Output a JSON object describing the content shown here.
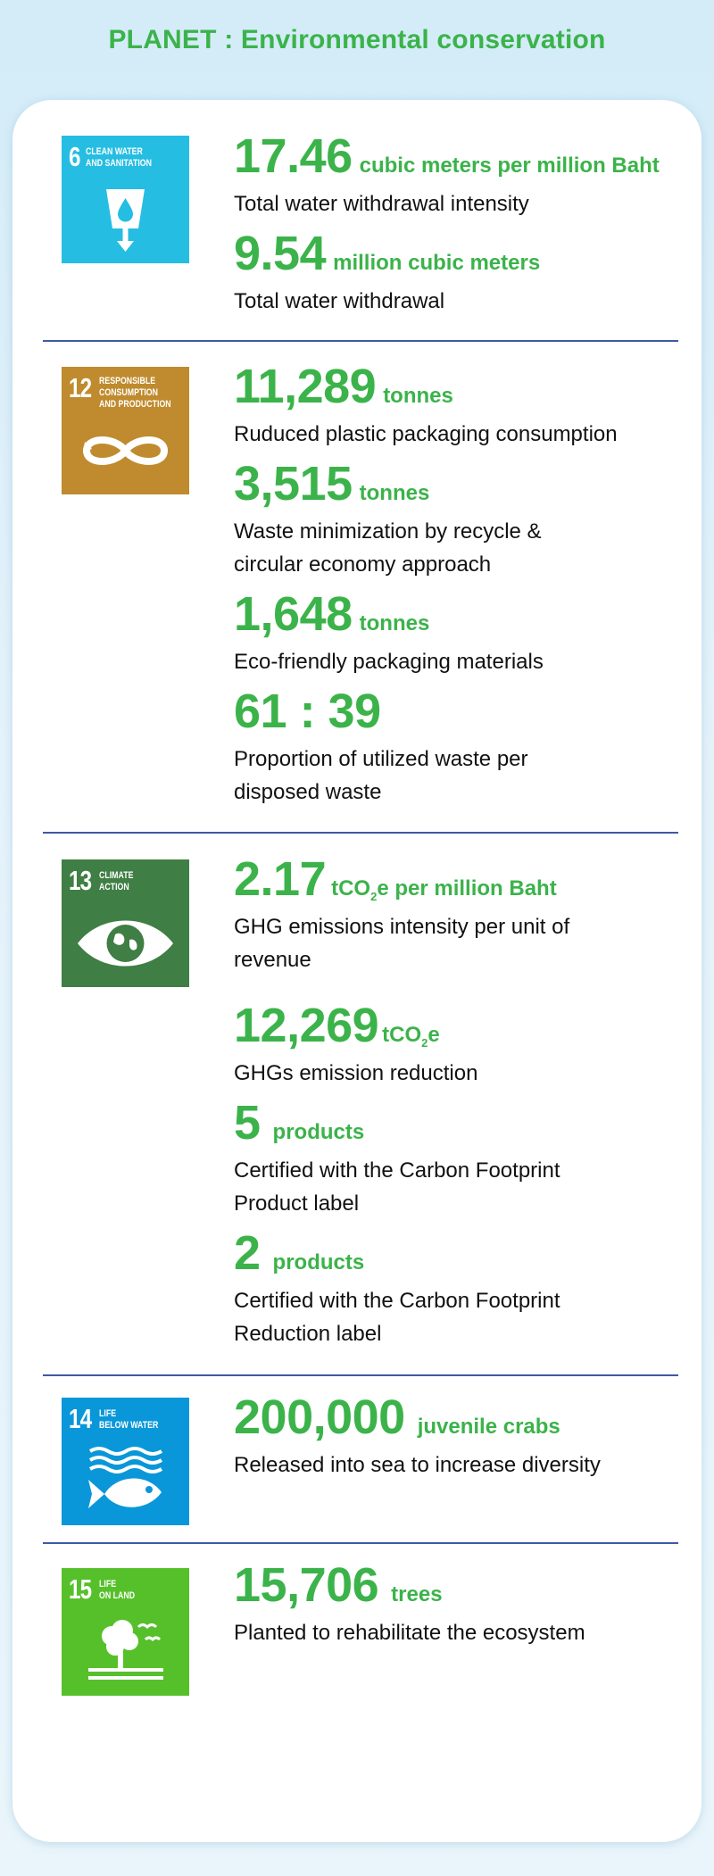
{
  "page_title": "PLANET : Environmental conservation",
  "colors": {
    "accent_green": "#3bb34a",
    "divider_blue": "#3f5aa3",
    "sdg6": "#26bde2",
    "sdg12": "#bf8b2e",
    "sdg13": "#3f7e44",
    "sdg14": "#0a97d9",
    "sdg15": "#56c02b"
  },
  "sections": [
    {
      "sdg": {
        "number": "6",
        "label": "CLEAN WATER\nAND SANITATION",
        "icon": "water-glass-icon"
      },
      "metrics": [
        {
          "value": "17.46",
          "unit": "cubic meters per million Baht",
          "desc": "Total water withdrawal intensity"
        },
        {
          "value": "9.54",
          "unit": "million cubic meters",
          "desc": "Total water withdrawal"
        }
      ]
    },
    {
      "sdg": {
        "number": "12",
        "label": "RESPONSIBLE\nCONSUMPTION\nAND PRODUCTION",
        "icon": "infinity-loop-icon"
      },
      "metrics": [
        {
          "value": "11,289",
          "unit": "tonnes",
          "desc": "Ruduced plastic packaging consumption"
        },
        {
          "value": "3,515",
          "unit": "tonnes",
          "desc": "Waste minimization by recycle & circular economy approach"
        },
        {
          "value": "1,648",
          "unit": "tonnes",
          "desc": "Eco-friendly packaging materials"
        },
        {
          "value": "61 : 39",
          "unit": "",
          "desc": "Proportion of utilized waste per disposed waste"
        }
      ]
    },
    {
      "sdg": {
        "number": "13",
        "label": "CLIMATE\nACTION",
        "icon": "eye-globe-icon"
      },
      "metrics": [
        {
          "value": "2.17",
          "unit_pre": "tCO",
          "unit_sub": "2",
          "unit_post": "e per million Baht",
          "desc": "GHG emissions intensity per unit of revenue"
        },
        {
          "value": "12,269",
          "unit_pre": "tCO",
          "unit_sub": "2",
          "unit_post": "e",
          "desc": "GHGs emission reduction"
        },
        {
          "value": "5",
          "unit": "products",
          "desc": "Certified with the Carbon Footprint Product label"
        },
        {
          "value": "2",
          "unit": "products",
          "desc": "Certified with the Carbon Footprint Reduction label"
        }
      ]
    },
    {
      "sdg": {
        "number": "14",
        "label": "LIFE\nBELOW WATER",
        "icon": "fish-waves-icon"
      },
      "metrics": [
        {
          "value": "200,000",
          "unit": "juvenile crabs",
          "desc": "Released into sea to increase diversity"
        }
      ]
    },
    {
      "sdg": {
        "number": "15",
        "label": "LIFE\nON LAND",
        "icon": "tree-birds-icon"
      },
      "metrics": [
        {
          "value": "15,706",
          "unit": "trees",
          "desc": "Planted to rehabilitate the ecosystem"
        }
      ]
    }
  ]
}
